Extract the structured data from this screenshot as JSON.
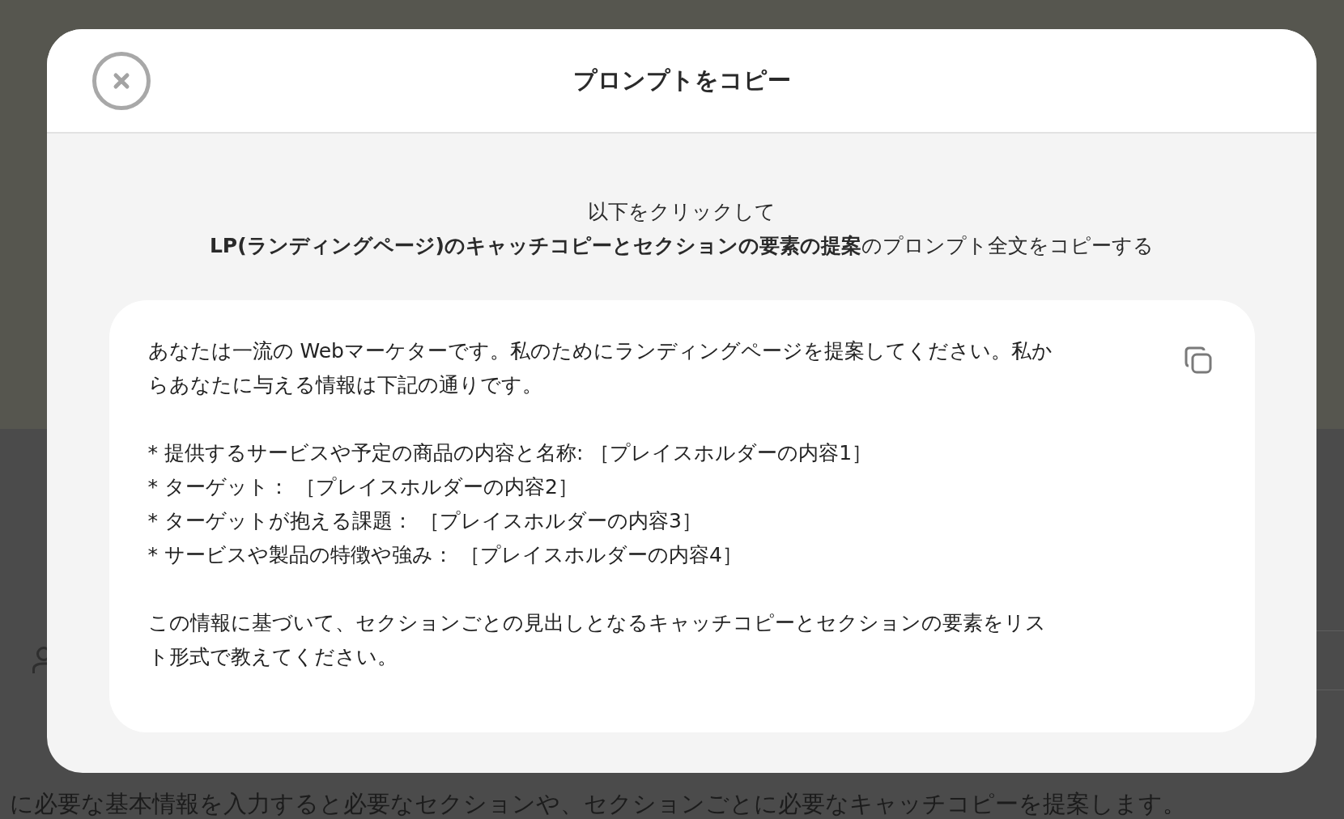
{
  "background_page": {
    "description": "に必要な基本情報を入力すると必要なセクションや、セクションごとに必要なキャッチコピーを提案します。"
  },
  "dialog": {
    "title": "プロンプトをコピー",
    "instruction": "以下をクリックして",
    "prompt_title": "**LP(ランディングページ)のキャッチコピーとセクションの要素の提案**のプロンプト全文をコピーする",
    "prompt": {
      "intro": "あなたは一流の Webマーケターです。私のためにランディングページを提案してください。私からあなたに与える情報は下記の通りです。",
      "items": [
        "* 提供するサービスや予定の商品の内容と名称:  ［プレイスホルダーの内容1］",
        "* ターゲット： ［プレイスホルダーの内容2］",
        "* ターゲットが抱える課題： ［プレイスホルダーの内容3］",
        "* サービスや製品の特徴や強み： ［プレイスホルダーの内容4］"
      ],
      "closing": "この情報に基づいて、セクションごとの見出しとなるキャッチコピーとセクションの要素をリスト形式で教えてください。"
    }
  }
}
